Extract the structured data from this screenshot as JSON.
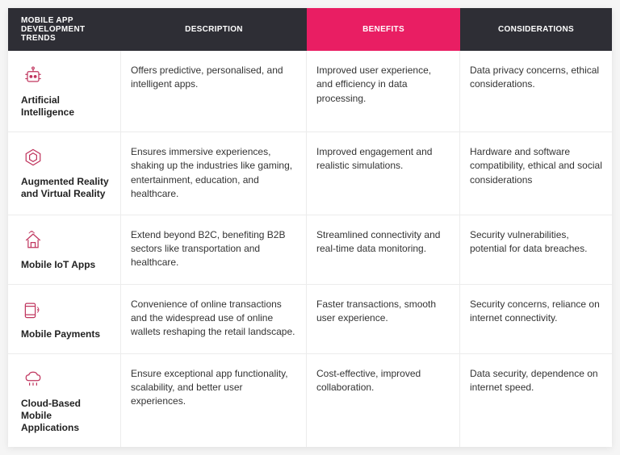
{
  "header": {
    "col1": "MOBILE APP DEVELOPMENT TRENDS",
    "col2": "DESCRIPTION",
    "col3": "BENEFITS",
    "col4": "CONSIDERATIONS"
  },
  "rows": [
    {
      "icon": "ai-icon",
      "name": "Artificial Intelligence",
      "description": "Offers predictive, personalised, and intelligent apps.",
      "benefits": "Improved user experience, and efficiency in data processing.",
      "considerations": "Data privacy concerns, ethical considerations."
    },
    {
      "icon": "arvr-icon",
      "name": "Augmented Reality and Virtual Reality",
      "description": "Ensures immersive experiences, shaking up the industries like gaming, entertainment, education, and healthcare.",
      "benefits": "Improved engagement and realistic simulations.",
      "considerations": "Hardware and software compatibility, ethical and social considerations"
    },
    {
      "icon": "iot-icon",
      "name": "Mobile IoT Apps",
      "description": "Extend beyond B2C, benefiting B2B sectors like transportation and healthcare.",
      "benefits": "Streamlined connectivity and real-time data monitoring.",
      "considerations": "Security vulnerabilities, potential for data breaches."
    },
    {
      "icon": "payment-icon",
      "name": "Mobile Payments",
      "description": "Convenience of online transactions and the widespread use of online wallets reshaping the retail landscape.",
      "benefits": "Faster transactions, smooth user experience.",
      "considerations": "Security concerns, reliance on internet connectivity."
    },
    {
      "icon": "cloud-icon",
      "name": "Cloud-Based Mobile Applications",
      "description": "Ensure exceptional app functionality, scalability, and better user experiences.",
      "benefits": "Cost-effective, improved collaboration.",
      "considerations": "Data security, dependence on internet speed."
    }
  ]
}
